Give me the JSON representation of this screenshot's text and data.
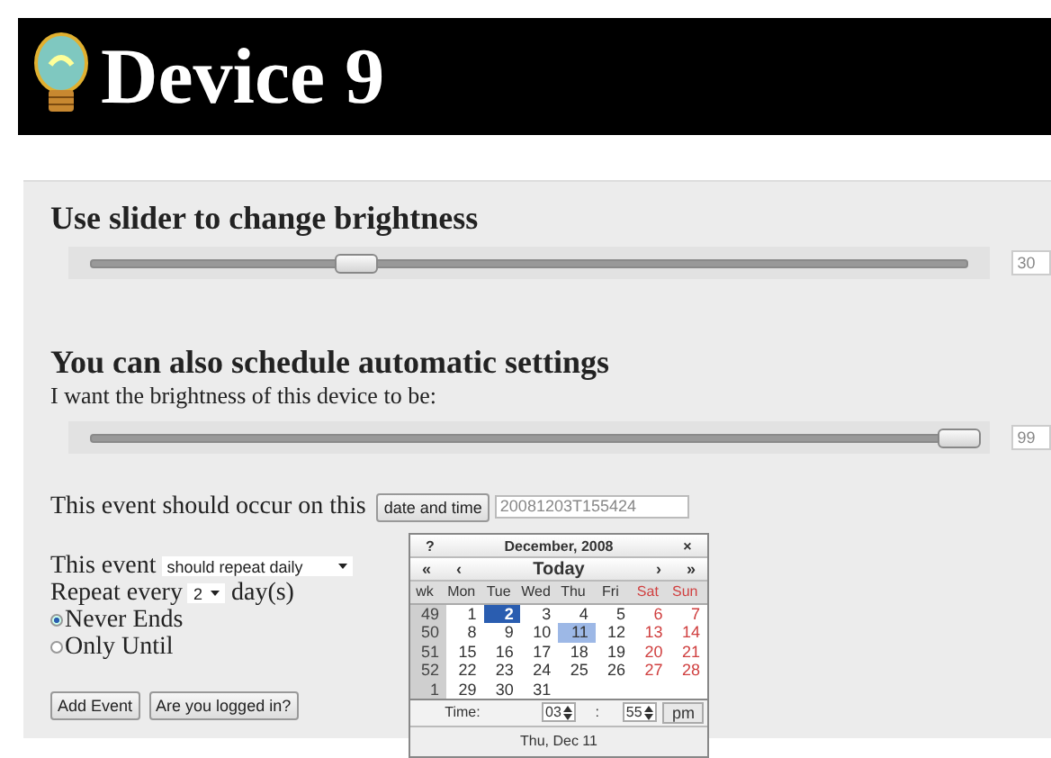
{
  "header": {
    "title": "Device 9"
  },
  "brightness": {
    "heading": "Use slider to change brightness",
    "level": 0.3,
    "reading": "30"
  },
  "schedule": {
    "heading": "You can also schedule automatic settings",
    "prompt": "I want the brightness of this device to be:",
    "level": 0.99,
    "reading": "99",
    "occur_label": "This event should occur on this",
    "date_button": "date and time",
    "date_value": "20081203T155424",
    "event_label": "This event",
    "event_select": "should repeat daily",
    "repeat_label": "Repeat every",
    "repeat_select": "2",
    "repeat_unit": "day(s)",
    "end_options": [
      {
        "label": "Never Ends",
        "selected": true
      },
      {
        "label": "Only Until",
        "selected": false
      }
    ],
    "buttons": [
      "Add Event",
      "Are you logged in?"
    ]
  },
  "calendar": {
    "help": "?",
    "title": "December, 2008",
    "close": "×",
    "nav": [
      "«",
      "‹",
      "Today",
      "›",
      "»"
    ],
    "week_header": "wk",
    "weekdays": [
      {
        "label": "Mon",
        "weekend": false
      },
      {
        "label": "Tue",
        "weekend": false
      },
      {
        "label": "Wed",
        "weekend": false
      },
      {
        "label": "Thu",
        "weekend": false
      },
      {
        "label": "Fri",
        "weekend": false
      },
      {
        "label": "Sat",
        "weekend": true
      },
      {
        "label": "Sun",
        "weekend": true
      }
    ],
    "weeks": [
      {
        "wk": "49",
        "days": [
          {
            "text": "1",
            "selected": false,
            "highlighted": false
          },
          {
            "text": "2",
            "selected": true,
            "highlighted": false
          },
          {
            "text": "3",
            "selected": false,
            "highlighted": false
          },
          {
            "text": "4",
            "selected": false,
            "highlighted": false
          },
          {
            "text": "5",
            "selected": false,
            "highlighted": false
          },
          {
            "text": "6",
            "selected": false,
            "highlighted": false
          },
          {
            "text": "7",
            "selected": false,
            "highlighted": false
          }
        ]
      },
      {
        "wk": "50",
        "days": [
          {
            "text": "8",
            "selected": false,
            "highlighted": false
          },
          {
            "text": "9",
            "selected": false,
            "highlighted": false
          },
          {
            "text": "10",
            "selected": false,
            "highlighted": false
          },
          {
            "text": "11",
            "selected": false,
            "highlighted": true
          },
          {
            "text": "12",
            "selected": false,
            "highlighted": false
          },
          {
            "text": "13",
            "selected": false,
            "highlighted": false
          },
          {
            "text": "14",
            "selected": false,
            "highlighted": false
          }
        ]
      },
      {
        "wk": "51",
        "days": [
          {
            "text": "15",
            "selected": false,
            "highlighted": false
          },
          {
            "text": "16",
            "selected": false,
            "highlighted": false
          },
          {
            "text": "17",
            "selected": false,
            "highlighted": false
          },
          {
            "text": "18",
            "selected": false,
            "highlighted": false
          },
          {
            "text": "19",
            "selected": false,
            "highlighted": false
          },
          {
            "text": "20",
            "selected": false,
            "highlighted": false
          },
          {
            "text": "21",
            "selected": false,
            "highlighted": false
          }
        ]
      },
      {
        "wk": "52",
        "days": [
          {
            "text": "22",
            "selected": false,
            "highlighted": false
          },
          {
            "text": "23",
            "selected": false,
            "highlighted": false
          },
          {
            "text": "24",
            "selected": false,
            "highlighted": false
          },
          {
            "text": "25",
            "selected": false,
            "highlighted": false
          },
          {
            "text": "26",
            "selected": false,
            "highlighted": false
          },
          {
            "text": "27",
            "selected": false,
            "highlighted": false
          },
          {
            "text": "28",
            "selected": false,
            "highlighted": false
          }
        ]
      },
      {
        "wk": "1",
        "days": [
          {
            "text": "29",
            "selected": false,
            "highlighted": false
          },
          {
            "text": "30",
            "selected": false,
            "highlighted": false
          },
          {
            "text": "31",
            "selected": false,
            "highlighted": false
          }
        ]
      }
    ],
    "time_label": "Time:",
    "hour": "03",
    "separator": ":",
    "minute": "55",
    "ampm": "pm",
    "footer": "Thu, Dec 11"
  }
}
